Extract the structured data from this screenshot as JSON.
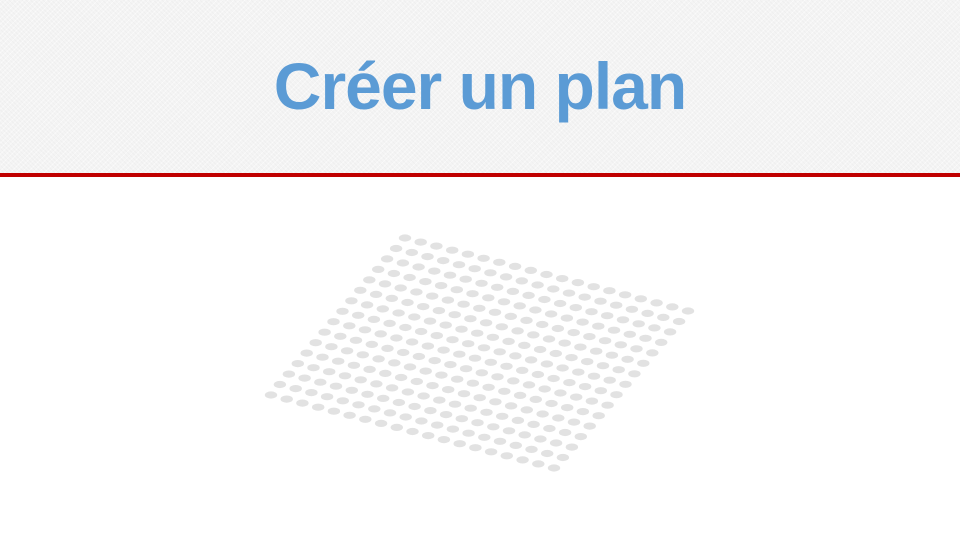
{
  "slide": {
    "title": "Créer un plan"
  },
  "dot_grid": {
    "rows": 16,
    "cols": 19,
    "color": "#e2e2e2"
  },
  "colors": {
    "title": "#5b9bd5",
    "rule": "#c00000",
    "header_bg": "#f4f4f4"
  }
}
